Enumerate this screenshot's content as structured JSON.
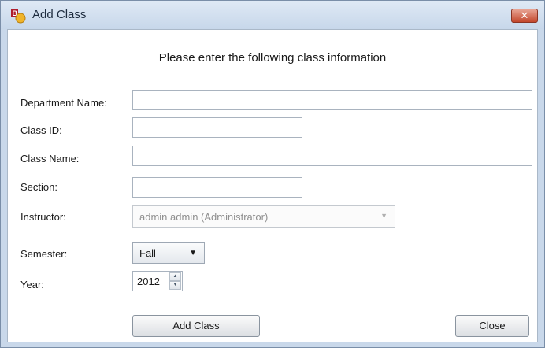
{
  "window": {
    "title": "Add Class",
    "close_glyph": "✕",
    "close_color": "#c3472c"
  },
  "form": {
    "heading": "Please enter the following class information",
    "department_label": "Department Name:",
    "department_value": "",
    "class_id_label": "Class ID:",
    "class_id_value": "",
    "class_name_label": "Class Name:",
    "class_name_value": "",
    "section_label": "Section:",
    "section_value": "",
    "instructor_label": "Instructor:",
    "instructor_value": "admin admin (Administrator)",
    "semester_label": "Semester:",
    "semester_value": "Fall",
    "year_label": "Year:",
    "year_value": "2012"
  },
  "buttons": {
    "add_class": "Add Class",
    "close": "Close"
  },
  "icons": {
    "app": "app-icon",
    "dropdown": "chevron-down-icon",
    "spin_up": "spin-up-icon",
    "spin_down": "spin-down-icon"
  }
}
